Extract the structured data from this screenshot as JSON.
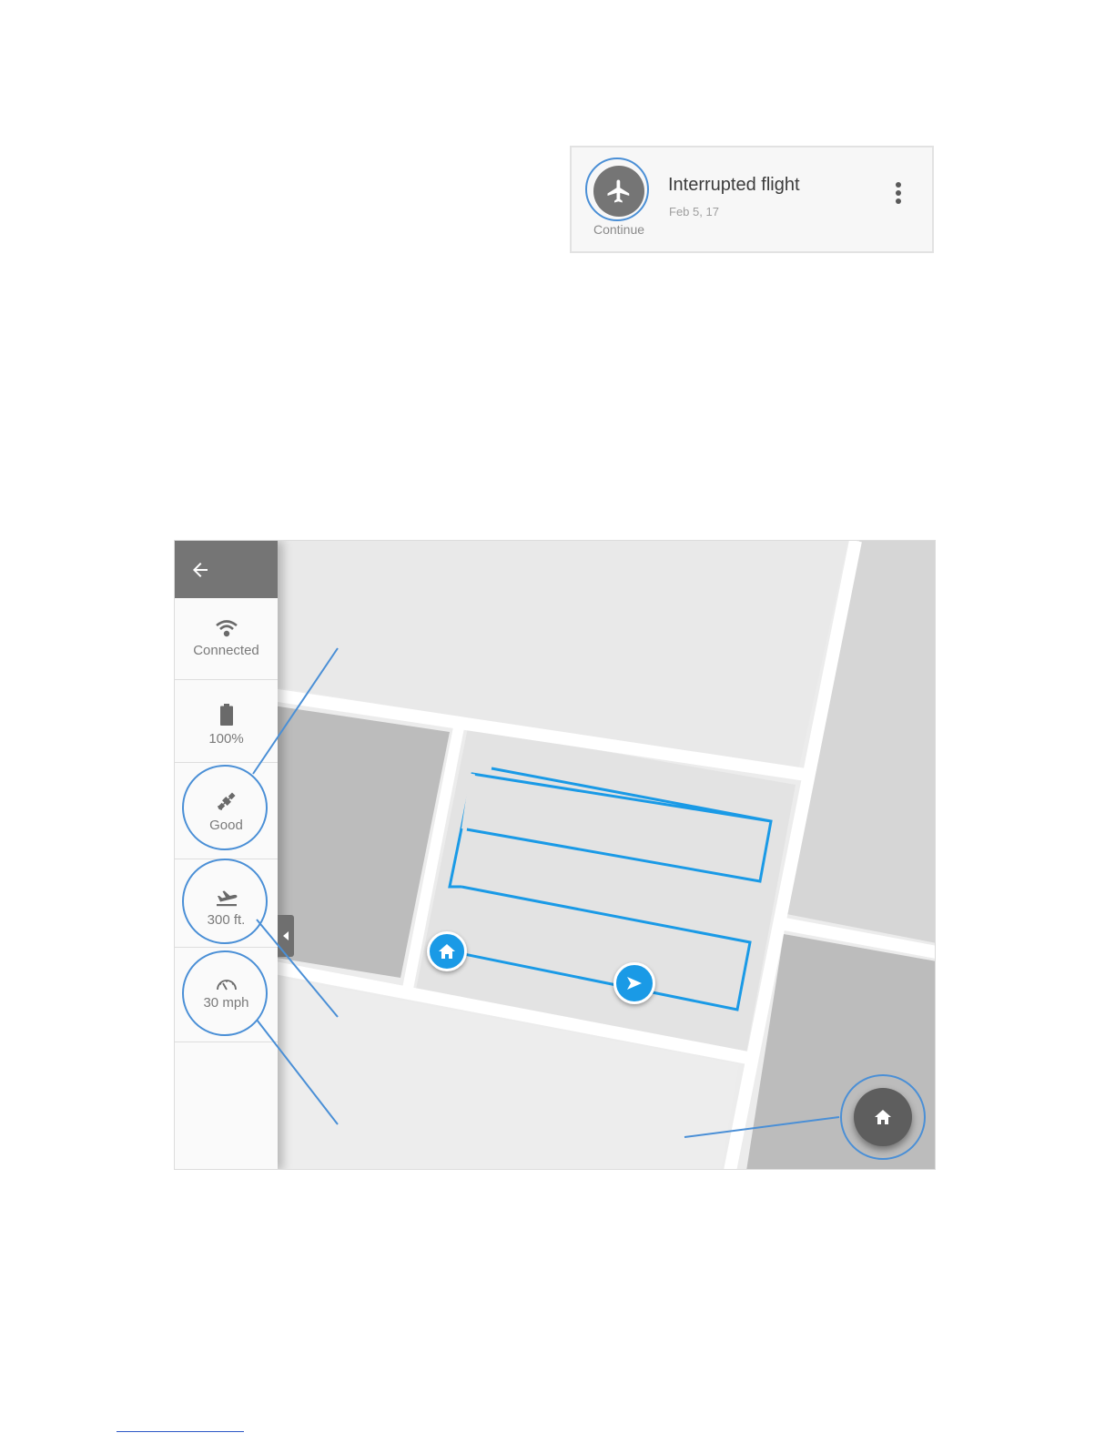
{
  "flight_card": {
    "title": "Interrupted flight",
    "date": "Feb 5, 17",
    "action_label": "Continue",
    "icon": "airplane-icon",
    "menu_icon": "more-vert-icon"
  },
  "sidebar": {
    "back_icon": "arrow-left-icon",
    "items": [
      {
        "icon": "wifi-icon",
        "label": "Connected"
      },
      {
        "icon": "battery-icon",
        "label": "100%"
      },
      {
        "icon": "satellite-icon",
        "label": "Good"
      },
      {
        "icon": "altitude-icon",
        "label": "300 ft."
      },
      {
        "icon": "speedometer-icon",
        "label": "30 mph"
      }
    ]
  },
  "map": {
    "home_marker_icon": "home-icon",
    "drone_marker_icon": "navigation-arrow-icon",
    "return_home_icon": "home-icon"
  },
  "colors": {
    "flight_path": "#1a9ae6",
    "annotation": "#4a8fd6",
    "sidebar_header": "#757575",
    "card_icon_bg": "#757575",
    "fab_bg": "#5e5e5e"
  }
}
